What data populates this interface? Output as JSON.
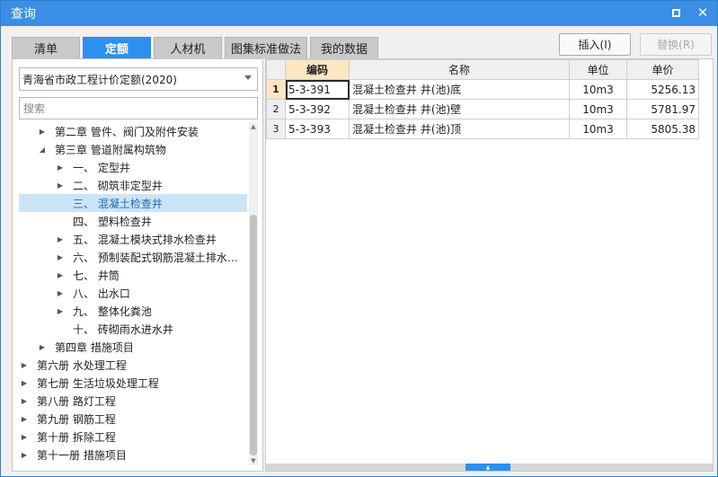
{
  "window": {
    "title": "查询"
  },
  "tabs": [
    {
      "label": "清单",
      "active": false
    },
    {
      "label": "定额",
      "active": true
    },
    {
      "label": "人材机",
      "active": false
    },
    {
      "label": "图集标准做法",
      "active": false
    },
    {
      "label": "我的数据",
      "active": false
    }
  ],
  "toolbar": {
    "insert_label": "插入(I)",
    "replace_label": "替换(R)"
  },
  "left": {
    "quota_select": "青海省市政工程计价定额(2020)",
    "search_placeholder": "搜索",
    "tree": [
      {
        "label": "第二章  管件、阀门及附件安装",
        "indent": 2,
        "expander": "collapsed"
      },
      {
        "label": "第三章  管道附属构筑物",
        "indent": 2,
        "expander": "expanded"
      },
      {
        "label": "一、  定型井",
        "indent": 3,
        "expander": "collapsed"
      },
      {
        "label": "二、  砌筑非定型井",
        "indent": 3,
        "expander": "collapsed"
      },
      {
        "label": "三、  混凝土检查井",
        "indent": 3,
        "expander": "none",
        "selected": true
      },
      {
        "label": "四、  塑料检查井",
        "indent": 3,
        "expander": "none"
      },
      {
        "label": "五、  混凝土模块式排水检查井",
        "indent": 3,
        "expander": "collapsed"
      },
      {
        "label": "六、  预制装配式钢筋混凝土排水…",
        "indent": 3,
        "expander": "collapsed"
      },
      {
        "label": "七、  井筒",
        "indent": 3,
        "expander": "collapsed"
      },
      {
        "label": "八、  出水口",
        "indent": 3,
        "expander": "collapsed"
      },
      {
        "label": "九、  整体化粪池",
        "indent": 3,
        "expander": "collapsed"
      },
      {
        "label": "十、  砖砌雨水进水井",
        "indent": 3,
        "expander": "none"
      },
      {
        "label": "第四章  措施项目",
        "indent": 2,
        "expander": "collapsed"
      },
      {
        "label": "第六册  水处理工程",
        "indent": 1,
        "expander": "collapsed"
      },
      {
        "label": "第七册  生活垃圾处理工程",
        "indent": 1,
        "expander": "collapsed"
      },
      {
        "label": "第八册  路灯工程",
        "indent": 1,
        "expander": "collapsed"
      },
      {
        "label": "第九册  钢筋工程",
        "indent": 1,
        "expander": "collapsed"
      },
      {
        "label": "第十册  拆除工程",
        "indent": 1,
        "expander": "collapsed"
      },
      {
        "label": "第十一册  措施项目",
        "indent": 1,
        "expander": "collapsed"
      }
    ]
  },
  "grid": {
    "headers": {
      "code": "编码",
      "name": "名称",
      "unit": "单位",
      "price": "单价"
    },
    "rows": [
      {
        "no": "1",
        "code": "5-3-391",
        "name": "混凝土检查井 井(池)底",
        "unit": "10m3",
        "price": "5256.13"
      },
      {
        "no": "2",
        "code": "5-3-392",
        "name": "混凝土检查井 井(池)壁",
        "unit": "10m3",
        "price": "5781.97"
      },
      {
        "no": "3",
        "code": "5-3-393",
        "name": "混凝土检查井 井(池)顶",
        "unit": "10m3",
        "price": "5805.38"
      }
    ]
  },
  "icons": {
    "maximize": "maximize-icon",
    "close": "close-icon",
    "expand_collapsed": "triangle-right-icon",
    "expand_expanded": "triangle-down-icon"
  }
}
